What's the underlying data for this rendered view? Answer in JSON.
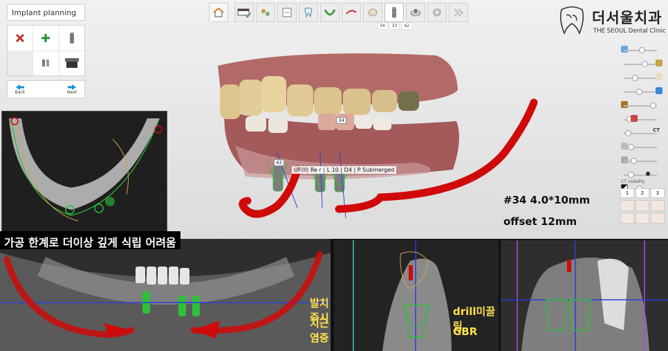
{
  "planning_panel": {
    "title": "Implant planning",
    "back_label": "Back",
    "next_label": "Next"
  },
  "toolbar": {
    "tooth_numbers": [
      "34",
      "33",
      "42"
    ]
  },
  "logo": {
    "name_ko": "더서울치과",
    "name_en": "THE SEOUL Dental Clinic"
  },
  "right_panel": {
    "ct_tag": "CT",
    "ct_visibility": "CT visibility",
    "view_tabs": [
      "1",
      "2",
      "3"
    ]
  },
  "view3d": {
    "implant_labels": [
      "42",
      "33",
      "34"
    ],
    "info_label": "UF(II) Re   r | L 10 | D4 | P Submerged",
    "spec_line1": "#34 4.0*10mm",
    "spec_line2": "offset 12mm"
  },
  "annotations": {
    "warning": "가공 한계로 더이상 깊게 식립 어려움",
    "immediate_1": "발치즉시",
    "immediate_2": "치근염증",
    "drill_1": "drill미끌림",
    "drill_2": "GBR"
  },
  "colors": {
    "nerve": "#d00a0a",
    "implant_green": "#2fbf3a",
    "annotation_yellow": "#ffe24a",
    "axis_blue": "#2a3fd8"
  }
}
